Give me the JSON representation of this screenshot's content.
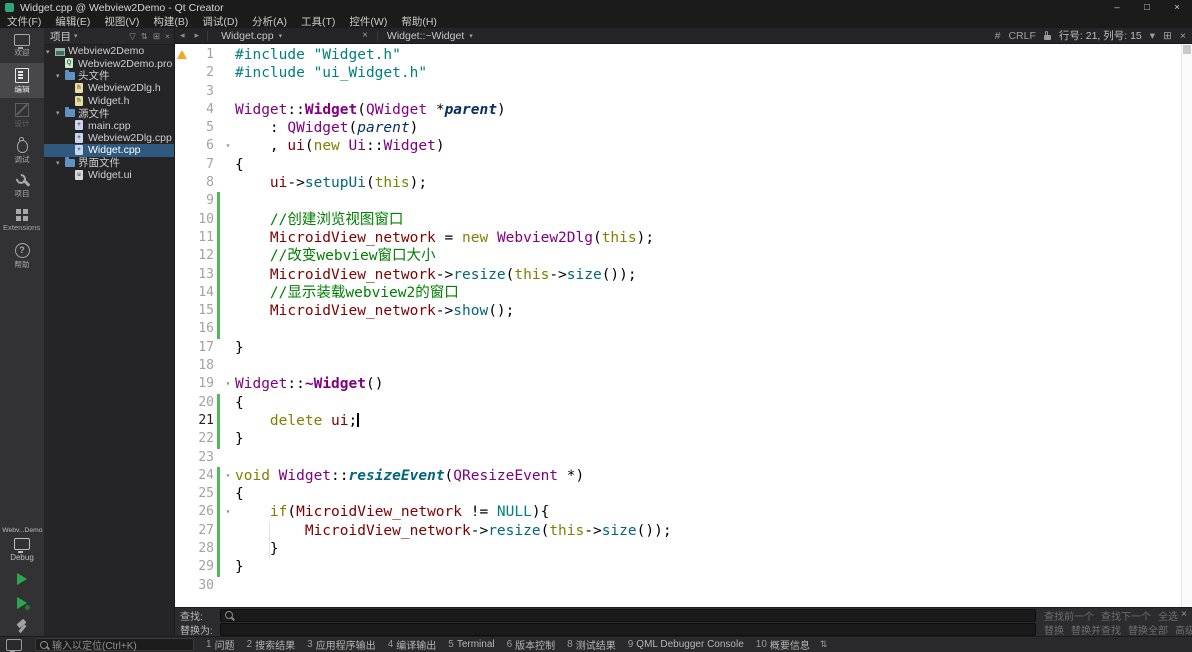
{
  "window": {
    "title": "Widget.cpp @ Webview2Demo - Qt Creator",
    "controls": {
      "minimize": "–",
      "maximize": "□",
      "close": "×"
    }
  },
  "menu": {
    "items": [
      "文件(F)",
      "编辑(E)",
      "视图(V)",
      "构建(B)",
      "调试(D)",
      "分析(A)",
      "工具(T)",
      "控件(W)",
      "帮助(H)"
    ]
  },
  "modebar": {
    "items": [
      {
        "id": "welcome",
        "label": "欢迎",
        "icon": "monitor-icon",
        "active": false,
        "enabled": true
      },
      {
        "id": "edit",
        "label": "编辑",
        "icon": "document-icon",
        "active": true,
        "enabled": true
      },
      {
        "id": "design",
        "label": "设计",
        "icon": "design-icon",
        "active": false,
        "enabled": false
      },
      {
        "id": "debug",
        "label": "调试",
        "icon": "bug-icon",
        "active": false,
        "enabled": true
      },
      {
        "id": "projects",
        "label": "项目",
        "icon": "wrench-icon",
        "active": false,
        "enabled": true
      },
      {
        "id": "extensions",
        "label": "Extensions",
        "icon": "puzzle-icon",
        "active": false,
        "enabled": true
      },
      {
        "id": "help",
        "label": "帮助",
        "icon": "help-icon",
        "active": false,
        "enabled": true
      }
    ],
    "kit": {
      "project": "Webv...Demo",
      "config": "Debug"
    }
  },
  "sidebar": {
    "header": {
      "title": "项目"
    },
    "tree": [
      {
        "label": "Webview2Demo",
        "level": 0,
        "type": "project",
        "expanded": true
      },
      {
        "label": "Webview2Demo.pro",
        "level": 1,
        "type": "pro"
      },
      {
        "label": "头文件",
        "level": 1,
        "type": "folder",
        "expanded": true
      },
      {
        "label": "Webview2Dlg.h",
        "level": 2,
        "type": "h"
      },
      {
        "label": "Widget.h",
        "level": 2,
        "type": "h"
      },
      {
        "label": "源文件",
        "level": 1,
        "type": "folder",
        "expanded": true
      },
      {
        "label": "main.cpp",
        "level": 2,
        "type": "cpp"
      },
      {
        "label": "Webview2Dlg.cpp",
        "level": 2,
        "type": "cpp"
      },
      {
        "label": "Widget.cpp",
        "level": 2,
        "type": "cpp",
        "selected": true
      },
      {
        "label": "界面文件",
        "level": 1,
        "type": "folder",
        "expanded": true
      },
      {
        "label": "Widget.ui",
        "level": 2,
        "type": "ui"
      }
    ]
  },
  "editorbar": {
    "document": "Widget.cpp",
    "symbol": "Widget::~Widget",
    "hash": "#",
    "encoding": "CRLF",
    "position": "行号: 21, 列号: 15"
  },
  "code": {
    "cursor": {
      "line": 21,
      "col": 15
    },
    "lines": [
      {
        "n": 1,
        "warn": true,
        "t": [
          [
            "pp",
            "#include"
          ],
          [
            "pl",
            " "
          ],
          [
            "str",
            "\"Widget.h\""
          ]
        ]
      },
      {
        "n": 2,
        "t": [
          [
            "pp",
            "#include"
          ],
          [
            "pl",
            " "
          ],
          [
            "str",
            "\"ui_Widget.h\""
          ]
        ]
      },
      {
        "n": 3,
        "t": []
      },
      {
        "n": 4,
        "t": [
          [
            "type",
            "Widget"
          ],
          [
            "pl",
            "::"
          ],
          [
            "typeb",
            "Widget"
          ],
          [
            "pl",
            "("
          ],
          [
            "type",
            "QWidget"
          ],
          [
            "pl",
            " *"
          ],
          [
            "locb",
            "parent"
          ],
          [
            "pl",
            ")"
          ]
        ]
      },
      {
        "n": 5,
        "t": [
          [
            "pl",
            "    : "
          ],
          [
            "type",
            "QWidget"
          ],
          [
            "pl",
            "("
          ],
          [
            "loc",
            "parent"
          ],
          [
            "pl",
            ")"
          ]
        ]
      },
      {
        "n": 6,
        "fold": true,
        "t": [
          [
            "pl",
            "    , "
          ],
          [
            "fld",
            "ui"
          ],
          [
            "pl",
            "("
          ],
          [
            "kw",
            "new"
          ],
          [
            "pl",
            " "
          ],
          [
            "type",
            "Ui"
          ],
          [
            "pl",
            "::"
          ],
          [
            "type",
            "Widget"
          ],
          [
            "pl",
            ")"
          ]
        ]
      },
      {
        "n": 7,
        "t": [
          [
            "pl",
            "{"
          ]
        ]
      },
      {
        "n": 8,
        "t": [
          [
            "pl",
            "    "
          ],
          [
            "fld",
            "ui"
          ],
          [
            "pl",
            "->"
          ],
          [
            "fn",
            "setupUi"
          ],
          [
            "pl",
            "("
          ],
          [
            "kw",
            "this"
          ],
          [
            "pl",
            ");"
          ]
        ]
      },
      {
        "n": 9,
        "chg": true,
        "t": []
      },
      {
        "n": 10,
        "chg": true,
        "t": [
          [
            "pl",
            "    "
          ],
          [
            "cm",
            "//创建浏览视图窗口"
          ]
        ]
      },
      {
        "n": 11,
        "chg": true,
        "t": [
          [
            "pl",
            "    "
          ],
          [
            "fld",
            "MicroidView_network"
          ],
          [
            "pl",
            " = "
          ],
          [
            "kw",
            "new"
          ],
          [
            "pl",
            " "
          ],
          [
            "type",
            "Webview2Dlg"
          ],
          [
            "pl",
            "("
          ],
          [
            "kw",
            "this"
          ],
          [
            "pl",
            ");"
          ]
        ]
      },
      {
        "n": 12,
        "chg": true,
        "t": [
          [
            "pl",
            "    "
          ],
          [
            "cm",
            "//改变webview窗口大小"
          ]
        ]
      },
      {
        "n": 13,
        "chg": true,
        "t": [
          [
            "pl",
            "    "
          ],
          [
            "fld",
            "MicroidView_network"
          ],
          [
            "pl",
            "->"
          ],
          [
            "fn",
            "resize"
          ],
          [
            "pl",
            "("
          ],
          [
            "kw",
            "this"
          ],
          [
            "pl",
            "->"
          ],
          [
            "fn",
            "size"
          ],
          [
            "pl",
            "());"
          ]
        ]
      },
      {
        "n": 14,
        "chg": true,
        "t": [
          [
            "pl",
            "    "
          ],
          [
            "cm",
            "//显示装载webview2的窗口"
          ]
        ]
      },
      {
        "n": 15,
        "chg": true,
        "t": [
          [
            "pl",
            "    "
          ],
          [
            "fld",
            "MicroidView_network"
          ],
          [
            "pl",
            "->"
          ],
          [
            "fn",
            "show"
          ],
          [
            "pl",
            "();"
          ]
        ]
      },
      {
        "n": 16,
        "chg": true,
        "t": []
      },
      {
        "n": 17,
        "t": [
          [
            "pl",
            "}"
          ]
        ]
      },
      {
        "n": 18,
        "t": []
      },
      {
        "n": 19,
        "fold": true,
        "t": [
          [
            "type",
            "Widget"
          ],
          [
            "pl",
            "::"
          ],
          [
            "typeb",
            "~Widget"
          ],
          [
            "pl",
            "()"
          ]
        ]
      },
      {
        "n": 20,
        "chg": true,
        "t": [
          [
            "pl",
            "{"
          ]
        ]
      },
      {
        "n": 21,
        "chg": true,
        "cur": true,
        "t": [
          [
            "pl",
            "    "
          ],
          [
            "kw",
            "delete"
          ],
          [
            "pl",
            " "
          ],
          [
            "fld",
            "ui"
          ],
          [
            "pl",
            ";"
          ]
        ]
      },
      {
        "n": 22,
        "chg": true,
        "t": [
          [
            "pl",
            "}"
          ]
        ]
      },
      {
        "n": 23,
        "t": []
      },
      {
        "n": 24,
        "fold": true,
        "chg": true,
        "t": [
          [
            "kw",
            "void"
          ],
          [
            "pl",
            " "
          ],
          [
            "type",
            "Widget"
          ],
          [
            "pl",
            "::"
          ],
          [
            "vfn",
            "resizeEvent"
          ],
          [
            "pl",
            "("
          ],
          [
            "type",
            "QResizeEvent"
          ],
          [
            "pl",
            " *)"
          ]
        ]
      },
      {
        "n": 25,
        "chg": true,
        "t": [
          [
            "pl",
            "{"
          ]
        ]
      },
      {
        "n": 26,
        "fold": true,
        "chg": true,
        "t": [
          [
            "pl",
            "    "
          ],
          [
            "kw",
            "if"
          ],
          [
            "pl",
            "("
          ],
          [
            "fld",
            "MicroidView_network"
          ],
          [
            "pl",
            " != "
          ],
          [
            "mac",
            "NULL"
          ],
          [
            "pl",
            "){"
          ]
        ]
      },
      {
        "n": 27,
        "chg": true,
        "guide": true,
        "t": [
          [
            "pl",
            "        "
          ],
          [
            "fld",
            "MicroidView_network"
          ],
          [
            "pl",
            "->"
          ],
          [
            "fn",
            "resize"
          ],
          [
            "pl",
            "("
          ],
          [
            "kw",
            "this"
          ],
          [
            "pl",
            "->"
          ],
          [
            "fn",
            "size"
          ],
          [
            "pl",
            "());"
          ]
        ]
      },
      {
        "n": 28,
        "chg": true,
        "guide": true,
        "t": [
          [
            "pl",
            "    }"
          ]
        ]
      },
      {
        "n": 29,
        "chg": true,
        "t": [
          [
            "pl",
            "}"
          ]
        ]
      },
      {
        "n": 30,
        "t": []
      }
    ]
  },
  "findbar": {
    "find_label": "查找:",
    "replace_label": "替换为:",
    "find_value": "",
    "replace_value": "",
    "find_buttons": [
      "查找前一个",
      "查找下一个",
      "全选"
    ],
    "replace_buttons": [
      "替换",
      "替换并查找",
      "替换全部",
      "高级..."
    ]
  },
  "statusbar": {
    "locator_placeholder": "输入以定位(Ctrl+K)",
    "panes": [
      {
        "num": "1",
        "label": "问题"
      },
      {
        "num": "2",
        "label": "搜索结果"
      },
      {
        "num": "3",
        "label": "应用程序输出"
      },
      {
        "num": "4",
        "label": "编译输出"
      },
      {
        "num": "5",
        "label": "Terminal"
      },
      {
        "num": "6",
        "label": "版本控制"
      },
      {
        "num": "8",
        "label": "测试结果"
      },
      {
        "num": "9",
        "label": "QML Debugger Console"
      },
      {
        "num": "10",
        "label": "概要信息"
      }
    ]
  },
  "icons": {
    "expanded": "▾",
    "collapsed": "▸",
    "fold": "▾",
    "caret_down": "▾",
    "back": "◂",
    "forward": "▸",
    "split": "⊞",
    "close": "×",
    "filter": "▽",
    "sync": "⇅",
    "panes_toggle": "⇅",
    "more": "▾",
    "plus": "+"
  },
  "colors": {
    "selection_blue": "#2f5a7d",
    "change_bar_green": "#4cbb5c",
    "run_green": "#2ea84f",
    "warning_orange": "#f5a623",
    "editor_bg": "#ffffff",
    "chrome_bg": "#252527",
    "syntax": {
      "preprocessor": "#008080",
      "string": "#008080",
      "keyword": "#808000",
      "type": "#800080",
      "field": "#800000",
      "function": "#00677c",
      "comment": "#008000",
      "local": "#092e64",
      "macro": "#008080"
    }
  }
}
